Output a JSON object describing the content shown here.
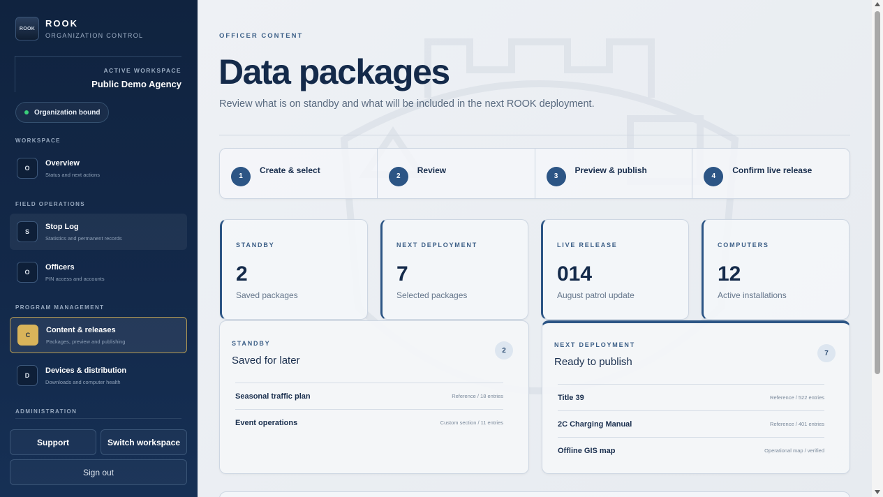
{
  "brand": {
    "logo_text": "ROOK",
    "name": "ROOK",
    "subtitle": "ORGANIZATION CONTROL"
  },
  "workspace": {
    "label": "ACTIVE WORKSPACE",
    "name": "Public Demo Agency",
    "status": "Organization bound",
    "status_color": "#3ad07a"
  },
  "sections": {
    "workspace": "WORKSPACE",
    "field_operations": "FIELD OPERATIONS",
    "program_management": "PROGRAM MANAGEMENT",
    "administration": "ADMINISTRATION"
  },
  "nav": [
    {
      "badge": "O",
      "title": "Overview",
      "desc": "Status and next actions"
    },
    {
      "badge": "S",
      "title": "Stop Log",
      "desc": "Statistics and permanent records"
    },
    {
      "badge": "O",
      "title": "Officers",
      "desc": "PIN access and accounts"
    },
    {
      "badge": "C",
      "title": "Content & releases",
      "desc": "Packages, preview and publishing",
      "active": true
    },
    {
      "badge": "D",
      "title": "Devices & distribution",
      "desc": "Downloads and computer health"
    }
  ],
  "buttons": {
    "support": "Support",
    "switch_workspace": "Switch workspace",
    "sign_out": "Sign out"
  },
  "header": {
    "eyebrow": "OFFICER CONTENT",
    "title": "Data packages",
    "description": "Review what is on standby and what will be included in the next ROOK deployment."
  },
  "steps": [
    {
      "num": "1",
      "label": "Create & select"
    },
    {
      "num": "2",
      "label": "Review"
    },
    {
      "num": "3",
      "label": "Preview & publish"
    },
    {
      "num": "4",
      "label": "Confirm live release"
    }
  ],
  "stats": [
    {
      "label": "STANDBY",
      "value": "2",
      "sub": "Saved packages"
    },
    {
      "label": "NEXT DEPLOYMENT",
      "value": "7",
      "sub": "Selected packages"
    },
    {
      "label": "LIVE RELEASE",
      "value": "014",
      "sub": "August patrol update"
    },
    {
      "label": "COMPUTERS",
      "value": "12",
      "sub": "Active installations"
    }
  ],
  "standby_panel": {
    "label": "STANDBY",
    "title": "Saved for later",
    "count": "2",
    "rows": [
      {
        "name": "Seasonal traffic plan",
        "meta": "Reference / 18 entries"
      },
      {
        "name": "Event operations",
        "meta": "Custom section / 11 entries"
      }
    ]
  },
  "deploy_panel": {
    "label": "NEXT DEPLOYMENT",
    "title": "Ready to publish",
    "count": "7",
    "rows": [
      {
        "name": "Title 39",
        "meta": "Reference / 522 entries"
      },
      {
        "name": "2C Charging Manual",
        "meta": "Reference / 401 entries"
      },
      {
        "name": "Offline GIS map",
        "meta": "Operational map / verified"
      }
    ]
  },
  "colors": {
    "sidebar": "#10233f",
    "accent": "#2c5585",
    "active_badge": "#d9b45a"
  }
}
